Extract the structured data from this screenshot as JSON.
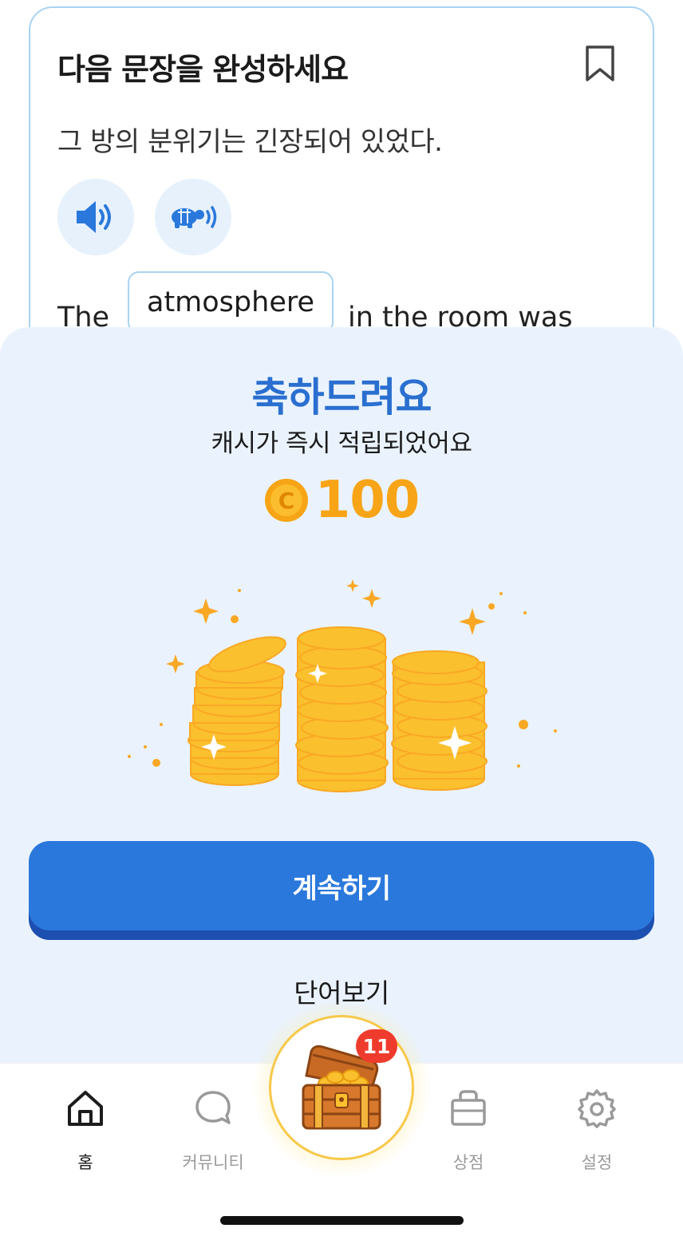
{
  "quiz": {
    "title": "다음 문장을 완성하세요",
    "sentence_korean": "그 방의 분위기는 긴장되어 있었다.",
    "word_before": "The",
    "selected_answer": "atmosphere",
    "words_after": "in the room was"
  },
  "reward": {
    "title": "축하드려요",
    "subtitle": "캐시가 즉시 적립되었어요",
    "amount": "100",
    "continue_label": "계속하기",
    "view_words_label": "단어보기"
  },
  "nav": {
    "home": "홈",
    "community": "커뮤니티",
    "shop": "상점",
    "settings": "설정",
    "chest_badge": "11"
  },
  "colors": {
    "accent_blue": "#2a78dc",
    "coin_gold": "#f7a416",
    "badge_red": "#ef3b2d"
  },
  "icons": {
    "bookmark": "bookmark-icon",
    "speaker": "speaker-icon",
    "slow_speaker": "turtle-speaker-icon",
    "coin": "coin-icon",
    "home": "home-icon",
    "community": "chat-bubble-icon",
    "chest": "treasure-chest-icon",
    "shop": "shopping-bag-icon",
    "settings": "gear-icon"
  }
}
